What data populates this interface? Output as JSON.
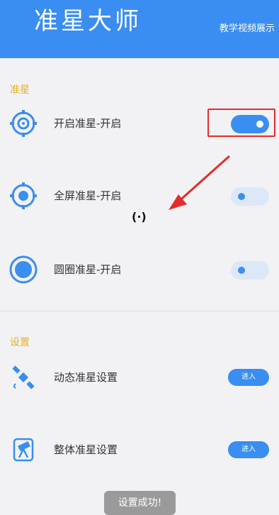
{
  "header": {
    "title": "准星大师",
    "link": "教学视频展示"
  },
  "sections": {
    "crosshair": "准星",
    "settings": "设置"
  },
  "rows": [
    {
      "label": "开启准星-开启",
      "icon": "crosshair-target-icon",
      "toggle_on": true
    },
    {
      "label": "全屏准星-开启",
      "icon": "crosshair-dot-icon",
      "toggle_on": false
    },
    {
      "label": "圆圈准星-开启",
      "icon": "circle-crosshair-icon",
      "toggle_on": false
    }
  ],
  "settings_rows": [
    {
      "label": "动态准星设置",
      "icon": "satellite-icon",
      "button": "进入"
    },
    {
      "label": "整体准星设置",
      "icon": "telescope-icon",
      "button": "进入"
    }
  ],
  "toast": "设置成功!",
  "cursor": "(·)",
  "colors": {
    "header": "#3a8ef1",
    "accent": "#3a8ef1",
    "section_label": "#e6b02e",
    "highlight": "#e52b2b"
  }
}
